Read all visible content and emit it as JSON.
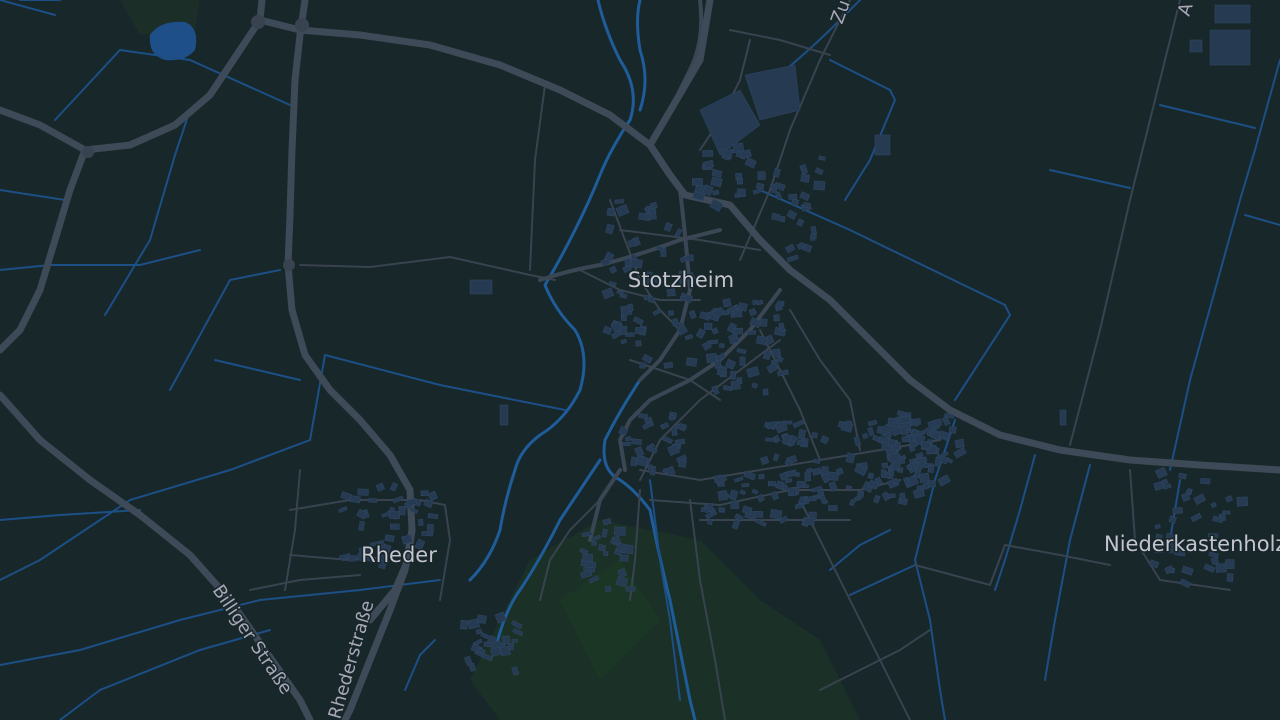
{
  "map": {
    "background_color": "#18272a",
    "water_color": "#1f5c9a",
    "road_color": "#3e4a57",
    "building_color": "#263a52",
    "forest_color": "#1c3226"
  },
  "places": {
    "stotzheim": "Stotzheim",
    "rheder": "Rheder",
    "niederkastenholz": "Niederkastenholz"
  },
  "roads": {
    "billiger_strasse": "Billiger Straße",
    "rhederstrasse": "Rhederstraße",
    "top_center_partial": "Zu",
    "top_right_partial": "A"
  }
}
